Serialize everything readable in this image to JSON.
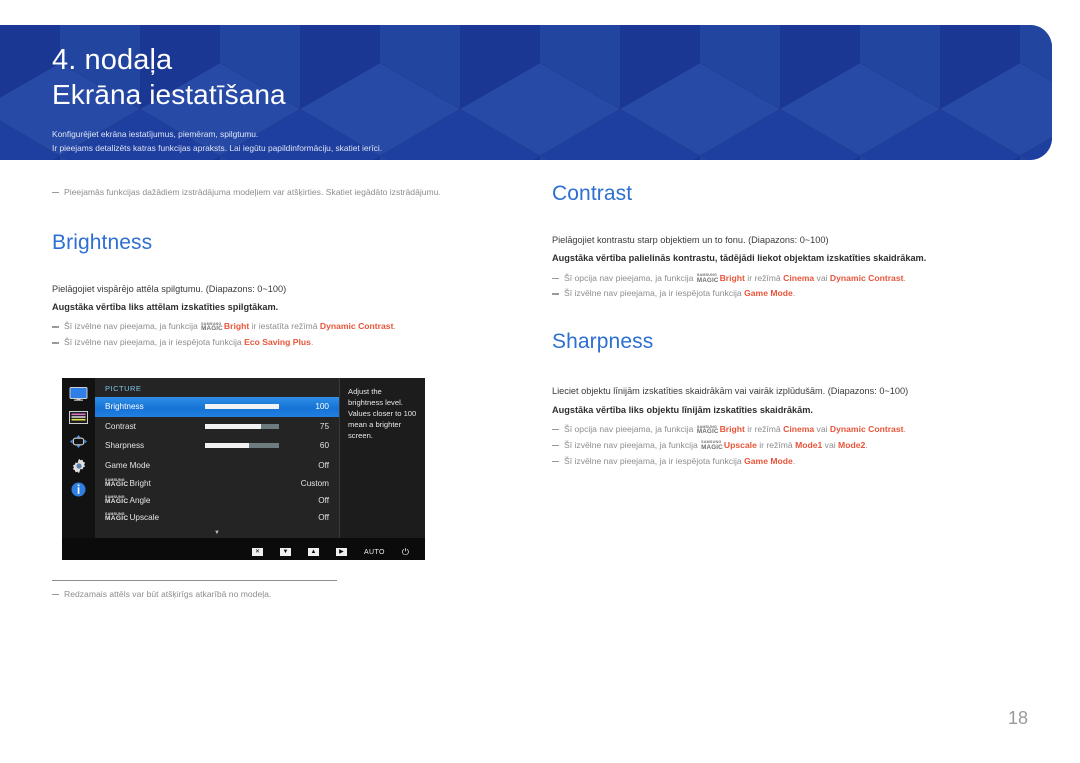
{
  "banner": {
    "chapter": "4. nodaļa",
    "title": "Ekrāna iestatīšana",
    "sub_line1": "Konfigurējiet ekrāna iestatījumus, piemēram, spilgtumu.",
    "sub_line2": "Ir pieejams detalizēts katras funkcijas apraksts. Lai iegūtu papildinformāciju, skatiet ierīci.",
    "bg_color": "#1e3fa0"
  },
  "intro_note": "Pieejamās funkcijas dažādiem izstrādājuma modeļiem var atšķirties. Skatiet iegādāto izstrādājumu.",
  "left": {
    "section_title": "Brightness",
    "body1": "Pielāgojiet vispārējo attēla spilgtumu. (Diapazons: 0~100)",
    "body2": "Augstāka vērtība liks attēlam izskatīties spilgtākam.",
    "note1_a": "Šī izvēlne nav pieejama, ja funkcija ",
    "note1_magic_small": "SAMSUNG",
    "note1_magic_big": "MAGIC",
    "note1_b": "Bright",
    "note1_c": " ir iestatīta režīmā ",
    "note1_d": "Dynamic Contrast",
    "note1_e": ".",
    "note2_a": "Šī izvēlne nav pieejama, ja ir iespējota funkcija ",
    "note2_b": "Eco Saving Plus",
    "note2_c": ".",
    "image_footnote": "Redzamais attēls var būt atšķirīgs atkarībā no modeļa."
  },
  "right": {
    "contrast": {
      "section_title": "Contrast",
      "body1": "Pielāgojiet kontrastu starp objektiem un to fonu. (Diapazons: 0~100)",
      "body2": "Augstāka vērtība palielinās kontrastu, tādējādi liekot objektam izskatīties skaidrākam.",
      "note1_a": "Šī opcija nav pieejama, ja funkcija ",
      "note1_b": "Bright",
      "note1_c": " ir režīmā ",
      "note1_d": "Cinema",
      "note1_e": " vai ",
      "note1_f": "Dynamic Contrast",
      "note1_g": ".",
      "note2_a": "Šī izvēlne nav pieejama, ja ir iespējota funkcija ",
      "note2_b": "Game Mode",
      "note2_c": "."
    },
    "sharpness": {
      "section_title": "Sharpness",
      "body1": "Lieciet objektu līnijām izskatīties skaidrākām vai vairāk izplūdušām. (Diapazons: 0~100)",
      "body2": "Augstāka vērtība liks objektu līnijām izskatīties skaidrākām.",
      "note1_a": "Šī opcija nav pieejama, ja funkcija ",
      "note1_b": "Bright",
      "note1_c": " ir režīmā ",
      "note1_d": "Cinema",
      "note1_e": " vai ",
      "note1_f": "Dynamic Contrast",
      "note1_g": ".",
      "note2_a": "Šī izvēlne nav pieejama, ja funkcija ",
      "note2_b": "Upscale",
      "note2_c": " ir režīmā ",
      "note2_d": "Mode1",
      "note2_e": " vai ",
      "note2_f": "Mode2",
      "note2_g": ".",
      "note3_a": "Šī izvēlne nav pieejama, ja ir iespējota funkcija ",
      "note3_b": "Game Mode",
      "note3_c": "."
    }
  },
  "osd": {
    "header": "PICTURE",
    "sidebar_icons": [
      "monitor-icon",
      "onscreen-display-icon",
      "system-icon",
      "setup-icon",
      "information-icon"
    ],
    "rows": [
      {
        "label": "Brightness",
        "value": "100",
        "bar": 100,
        "selected": true,
        "type": "slider"
      },
      {
        "label": "Contrast",
        "value": "75",
        "bar": 75,
        "selected": false,
        "type": "slider"
      },
      {
        "label": "Sharpness",
        "value": "60",
        "bar": 60,
        "selected": false,
        "type": "slider"
      },
      {
        "label": "Game Mode",
        "value": "Off",
        "selected": false,
        "type": "value"
      }
    ],
    "magic_rows": [
      {
        "small": "SAMSUNG",
        "big": "MAGIC",
        "suffix": "Bright",
        "value": "Custom"
      },
      {
        "small": "SAMSUNG",
        "big": "MAGIC",
        "suffix": "Angle",
        "value": "Off"
      },
      {
        "small": "SAMSUNG",
        "big": "MAGIC",
        "suffix": "Upscale",
        "value": "Off"
      }
    ],
    "more_caret": "▼",
    "tooltip": "Adjust the brightness level. Values closer to 100 mean a brighter screen.",
    "bottom_keys": [
      "✕",
      "▼",
      "▲",
      "▶"
    ],
    "auto_label": "AUTO",
    "power_glyph": "⏻",
    "highlight_color": "#1e7fe0"
  },
  "page_number": "18"
}
